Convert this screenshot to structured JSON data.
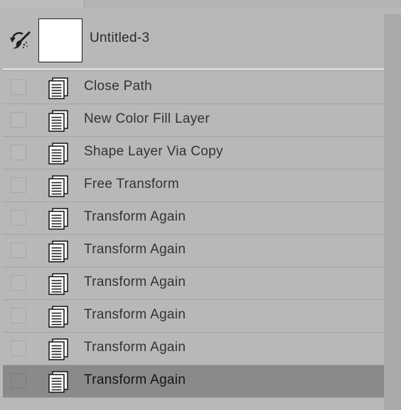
{
  "snapshot": {
    "label": "Untitled-3",
    "brush_icon": "history-brush-icon"
  },
  "history": {
    "items": [
      {
        "label": "Close Path",
        "icon": "document-icon",
        "selected": false
      },
      {
        "label": "New Color Fill Layer",
        "icon": "document-icon",
        "selected": false
      },
      {
        "label": "Shape Layer Via Copy",
        "icon": "document-icon",
        "selected": false
      },
      {
        "label": "Free Transform",
        "icon": "document-icon",
        "selected": false
      },
      {
        "label": "Transform Again",
        "icon": "document-icon",
        "selected": false
      },
      {
        "label": "Transform Again",
        "icon": "document-icon",
        "selected": false
      },
      {
        "label": "Transform Again",
        "icon": "document-icon",
        "selected": false
      },
      {
        "label": "Transform Again",
        "icon": "document-icon",
        "selected": false
      },
      {
        "label": "Transform Again",
        "icon": "document-icon",
        "selected": false
      },
      {
        "label": "Transform Again",
        "icon": "document-icon",
        "selected": true
      }
    ]
  },
  "colors": {
    "panel_bg": "#b8b8b8",
    "selected_row_bg": "#8a8a8a"
  }
}
